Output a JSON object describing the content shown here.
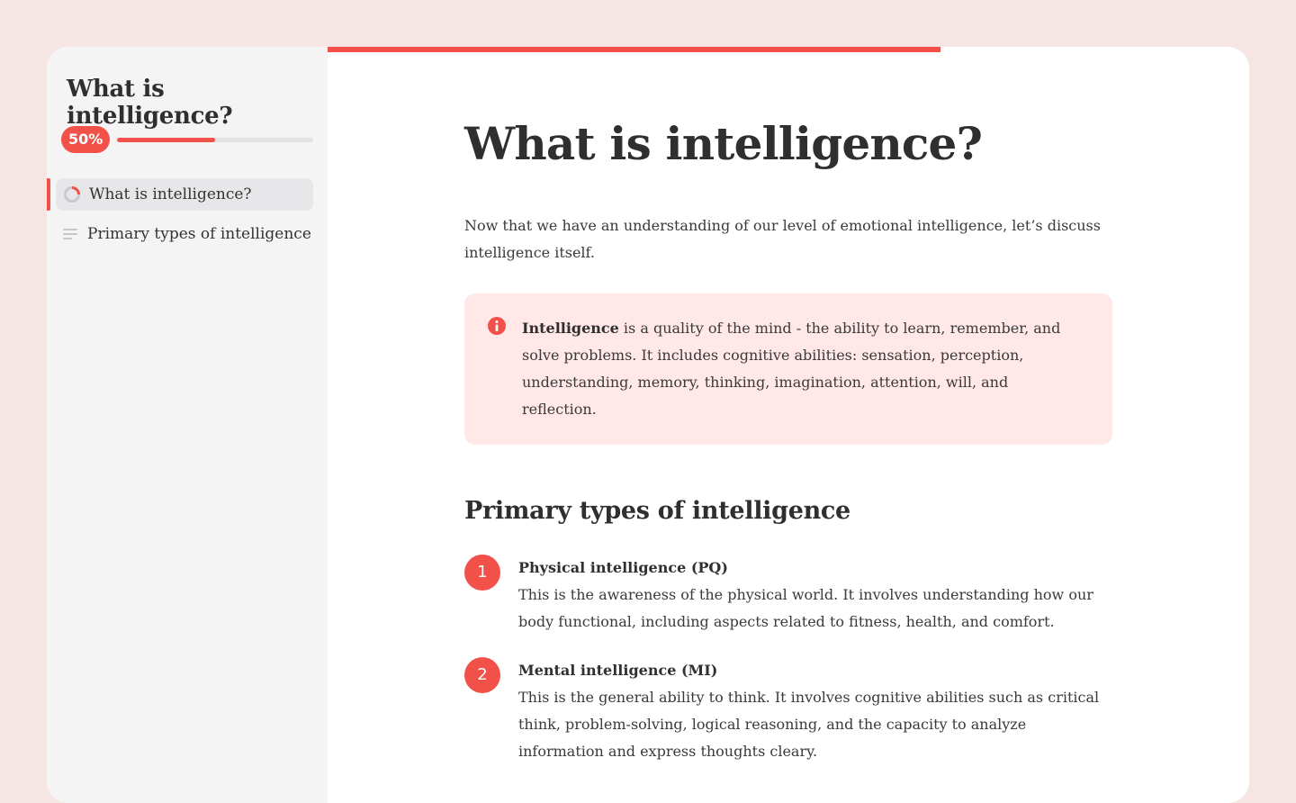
{
  "course": {
    "title": "What is intelligence?",
    "progress_label": "50%",
    "progress_fraction": 0.5,
    "page_progress_fraction": 0.665
  },
  "nav": {
    "items": [
      {
        "label": "What is intelligence?",
        "active": true,
        "icon": "progress-ring-icon"
      },
      {
        "label": "Primary types of intelligence",
        "active": false,
        "icon": "text-lines-icon"
      }
    ]
  },
  "content": {
    "title": "What is intelligence?",
    "intro": "Now that we have an understanding of our level of emotional intelligence, let’s discuss intelligence itself.",
    "callout": {
      "icon": "info-icon",
      "term": "Intelligence",
      "text": " is a quality of the mind - the ability to learn, remember, and solve problems. It includes cognitive abilities: sensation, perception, understanding, memory, thinking, imagination, attention, will, and reflection."
    },
    "section_title": "Primary types of intelligence",
    "types": [
      {
        "number": "1",
        "title": "Physical intelligence (PQ)",
        "text": "This is the awareness of the physical world. It involves understanding how our body functional, including aspects related to fitness, health, and comfort."
      },
      {
        "number": "2",
        "title": "Mental intelligence (MI)",
        "text": "This is the general ability to think. It involves cognitive abilities such as critical think, problem-solving, logical reasoning, and the capacity to analyze information and express thoughts cleary."
      }
    ]
  },
  "colors": {
    "accent": "#f25149",
    "background": "#f5e5e3",
    "sidebar": "#f4f4f5",
    "callout": "#ffe8e7"
  }
}
